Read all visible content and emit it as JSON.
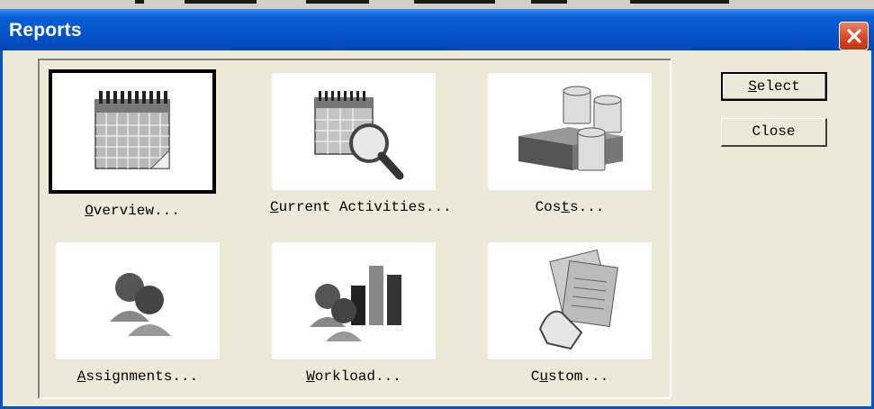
{
  "window": {
    "title": "Reports"
  },
  "buttons": {
    "select": {
      "pre": "",
      "u": "S",
      "post": "elect"
    },
    "close": "Close"
  },
  "reports": [
    {
      "pre": "",
      "u": "O",
      "post": "verview...",
      "icon": "calendar-icon"
    },
    {
      "pre": "",
      "u": "C",
      "post": "urrent Activities...",
      "icon": "calendar-magnifier-icon"
    },
    {
      "pre": "Cos",
      "u": "t",
      "post": "s...",
      "icon": "money-coins-icon"
    },
    {
      "pre": "",
      "u": "A",
      "post": "ssignments...",
      "icon": "people-icon"
    },
    {
      "pre": "",
      "u": "W",
      "post": "orkload...",
      "icon": "people-bar-chart-icon"
    },
    {
      "pre": "C",
      "u": "u",
      "post": "stom...",
      "icon": "hand-documents-icon"
    }
  ]
}
